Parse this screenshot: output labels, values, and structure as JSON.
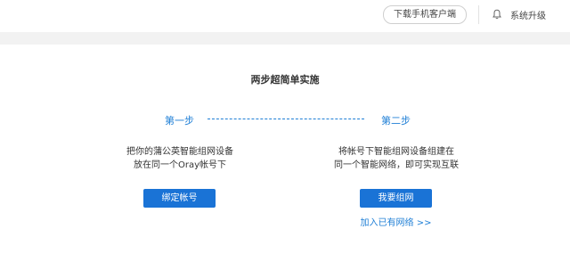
{
  "header": {
    "download_button": "下载手机客户端",
    "upgrade_label": "系统升级",
    "upgrade_icon": "bell-icon"
  },
  "main": {
    "title": "两步超简单实施",
    "step1": {
      "label": "第一步",
      "desc_line1": "把你的蒲公英智能组网设备",
      "desc_line2": "放在同一个Oray帐号下",
      "button": "绑定帐号"
    },
    "step2": {
      "label": "第二步",
      "desc_line1": "将帐号下智能组网设备组建在",
      "desc_line2": "同一个智能网络，即可实现互联",
      "button": "我要组网",
      "link": "加入已有网络 >>"
    }
  },
  "colors": {
    "accent": "#1a73d6",
    "link": "#1f7fd6",
    "strip": "#f2f2f2"
  }
}
